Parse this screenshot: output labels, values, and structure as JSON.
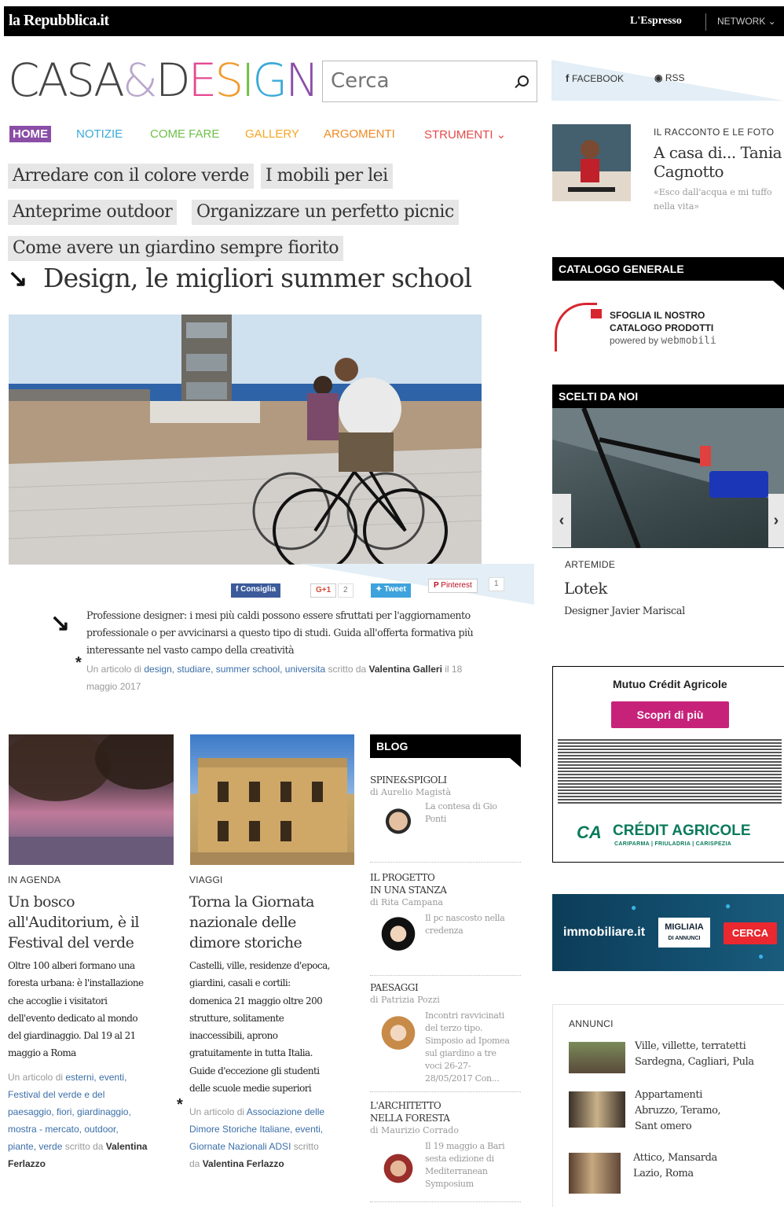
{
  "topbar": {
    "logo": "la Repubblica.it",
    "espresso": "L'Espresso",
    "network": "NETWORK ⌄"
  },
  "brand": {
    "c1": "CASA",
    "amp": "&",
    "d": "D",
    "e": "E",
    "s": "S",
    "i": "I",
    "g": "G",
    "n": "N"
  },
  "search": {
    "placeholder": "Cerca"
  },
  "social": {
    "facebook": "FACEBOOK",
    "rss": "RSS"
  },
  "nav": {
    "home": "HOME",
    "notizie": "NOTIZIE",
    "come_fare": "COME FARE",
    "gallery": "GALLERY",
    "argomenti": "ARGOMENTI",
    "strumenti": "STRUMENTI ⌄"
  },
  "nav_colors": {
    "home_bg": "#8b4ea6",
    "notizie": "#3aaad8",
    "come_fare": "#6ec04a",
    "gallery": "#f5a623",
    "argomenti": "#f08a24",
    "strumenti": "#e44a4a"
  },
  "tags": [
    "Arredare con il colore verde",
    "I mobili per lei",
    "Anteprime outdoor",
    "Organizzare un perfetto picnic",
    "Come avere un giardino sempre fiorito"
  ],
  "article": {
    "headline": "Design, le migliori summer school",
    "share": {
      "facebook": "Consiglia",
      "gplus": "G+1",
      "gplus_count": "2",
      "twitter": "Tweet",
      "pinterest": "Pinterest",
      "pin_count": "1"
    },
    "lead": "Professione designer: i mesi più caldi possono essere sfruttati per l'aggiornamento professionale o per avvicinarsi a questo tipo di studi. Guida all'offerta formativa più interessante nel vasto campo della creatività",
    "meta_prefix": "Un articolo di",
    "tags": "design, studiare, summer school, universita",
    "meta_mid": "scritto da",
    "author": "Valentina Galleri",
    "date_part1": "il 18",
    "date_part2": "maggio 2017"
  },
  "right": {
    "racconto_label": "IL RACCONTO E LE FOTO",
    "racconto_title1": "A casa di... Tania",
    "racconto_title2": "Cagnotto",
    "racconto_quote1": "«Esco dall'acqua e mi tuffo",
    "racconto_quote2": "nella vita»",
    "catalogo_head": "CATALOGO GENERALE",
    "catalogo_line1": "SFOGLIA IL NOSTRO",
    "catalogo_line2": "CATALOGO PRODOTTI",
    "catalogo_powered": "powered by",
    "catalogo_brand": "webmobili",
    "scelti_head": "SCELTI DA NOI",
    "scelti_brand": "ARTEMIDE",
    "scelti_product": "Lotek",
    "scelti_designer": "Designer Javier Mariscal",
    "ad_title": "Mutuo Crédit Agricole",
    "ad_button": "Scopri di più",
    "ad_brand": "CRÉDIT AGRICOLE",
    "ad_sub": "CARIPARMA | FRIULADRIA | CARISPEZIA",
    "imm_brand": "immobiliare.it",
    "imm_badge1": "MIGLIAIA",
    "imm_badge2": "DI ANNUNCI",
    "imm_button": "CERCA",
    "annunci_head": "ANNUNCI",
    "annunci": [
      {
        "l1": "Ville, villette, terratetti",
        "l2": "Sardegna, Cagliari, Pula",
        "l3": ""
      },
      {
        "l1": "Appartamenti",
        "l2": "Abruzzo, Teramo,",
        "l3": "Sant omero"
      },
      {
        "l1": "Attico, Mansarda",
        "l2": "Lazio, Roma",
        "l3": ""
      }
    ]
  },
  "cards": [
    {
      "cat": "IN AGENDA",
      "title": [
        "Un bosco",
        "all'Auditorium, è il",
        "Festival del verde"
      ],
      "text": [
        "Oltre 100 alberi formano una",
        "foresta urbana: è l'installazione",
        "che accoglie i visitatori",
        "dell'evento dedicato al mondo",
        "del giardinaggio. Dal 19 al 21",
        "maggio a Roma"
      ],
      "meta_prefix": "Un articolo di",
      "tags1": "esterni, eventi,",
      "tags2": "Festival del verde e del",
      "tags3": "paesaggio, fiori, giardinaggio,",
      "tags4": "mostra - mercato, outdoor,",
      "tags5": "piante, verde",
      "meta_mid": "scritto da",
      "author1": "Valentina",
      "author2": "Ferlazzo"
    },
    {
      "cat": "VIAGGI",
      "title": [
        "Torna la Giornata",
        "nazionale delle",
        "dimore storiche"
      ],
      "text": [
        "Castelli, ville, residenze d'epoca,",
        "giardini, casali e cortili:",
        "domenica 21 maggio oltre 200",
        "strutture, solitamente",
        "inaccessibili, aprono",
        "gratuitamente in tutta Italia.",
        "Guide d'eccezione gli studenti",
        "delle scuole medie superiori"
      ],
      "meta_prefix": "Un articolo di",
      "tags1": "Associazione delle",
      "tags2": "Dimore Storiche Italiane, eventi,",
      "tags3": "Giornate Nazionali ADSI",
      "meta_mid": "scritto",
      "meta_da": "da",
      "author": "Valentina Ferlazzo"
    }
  ],
  "blog": {
    "head": "BLOG",
    "items": [
      {
        "h1": "SPINE&SPIGOLI",
        "h2": "",
        "author": "di Aurelio Magistà",
        "t": [
          "La contesa di Gio",
          "Ponti"
        ]
      },
      {
        "h1": "IL PROGETTO",
        "h2": "IN UNA STANZA",
        "author": "di Rita Campana",
        "t": [
          "Il pc nascosto nella",
          "credenza"
        ]
      },
      {
        "h1": "PAESAGGI",
        "h2": "",
        "author": "di Patrizia Pozzi",
        "t": [
          "Incontri ravvicinati",
          "del terzo tipo.",
          "Simposio ad Ipomea",
          "sul giardino a tre",
          "voci 26-27-",
          "28/05/2017 Con..."
        ]
      },
      {
        "h1": "L'ARCHITETTO",
        "h2": "NELLA FORESTA",
        "author": "di Maurizio Corrado",
        "t": [
          "Il 19 maggio a Bari",
          "sesta edizione di",
          "Mediterranean",
          "Symposium"
        ]
      }
    ]
  }
}
